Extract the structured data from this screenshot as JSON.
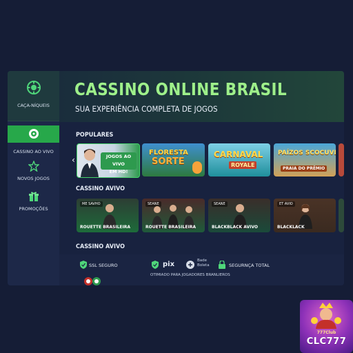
{
  "sidebar": {
    "items": [
      {
        "label": "CAÇA-NÍQUEIS",
        "icon": "slot-chip-icon"
      },
      {
        "label": "CASSINO AO VIVO",
        "icon": "roulette-icon"
      },
      {
        "label": "NOVOS JOGOS",
        "icon": "star-icon"
      },
      {
        "label": "PROMOÇÕES",
        "icon": "gift-icon"
      }
    ]
  },
  "hero": {
    "title": "CASSINO ONLINE BRASIL",
    "subtitle": "SUA EXPERIÊNCIA COMPLETA DE JOGOS"
  },
  "sections": {
    "populares": "POPULARES",
    "cassino_avivo_1": "CASSINO AVIVO",
    "cassino_avivo_2": "CASSINO AVIVO"
  },
  "populares": {
    "promo_line1": "JOGOS AO VIVO",
    "promo_line2": "EM HD!",
    "games": [
      {
        "title_top": "FLORESTA",
        "title_bottom": "SORTE"
      },
      {
        "title_top": "CARNAVAL",
        "title_bottom": "ROYALE"
      },
      {
        "title_top": "PAÍZOS SCOCUVE",
        "title_bottom": "PRAIA DO PRÊMIO"
      }
    ]
  },
  "live": {
    "tiles": [
      {
        "badge": "ME SAVHO",
        "caption": "ROUETTE BRASILEIRA"
      },
      {
        "badge": "SEANE",
        "caption": "ROUETTE BRASILEIRA"
      },
      {
        "badge": "SEANE",
        "caption": "BLACKBLACK AVIVO"
      },
      {
        "badge": "ET AVIO",
        "caption": "BLACKLACK"
      }
    ]
  },
  "footer": {
    "ssl": "SSL SEGURO",
    "pix": "pix",
    "boleto_line1": "Bade",
    "boleto_line2": "Boleta",
    "seguranca": "SEGURNÇA TOTAL",
    "optimized": "OTIMIADO PARA JOGADORES BRANLIEROS"
  },
  "logo": {
    "club": "777Club",
    "text": "CLC777"
  },
  "colors": {
    "accent_green": "#9ef08a",
    "active_green": "#27a84a"
  }
}
